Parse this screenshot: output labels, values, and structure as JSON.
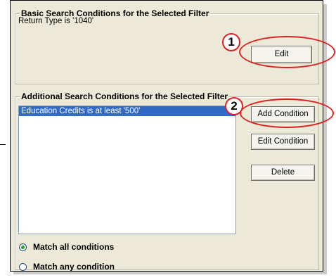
{
  "basic_group": {
    "title": "Basic Search Conditions for the Selected Filter",
    "condition_text": "Return Type is '1040'",
    "edit_label": "Edit"
  },
  "additional_group": {
    "title": "Additional Search Conditions for the Selected Filter",
    "list_items": [
      "Education Credits is at least '500'"
    ],
    "add_condition_label": "Add Condition",
    "edit_condition_label": "Edit Condition",
    "delete_label": "Delete"
  },
  "match_options": {
    "all_label": "Match all conditions",
    "any_label": "Match any condition",
    "selected": "all"
  },
  "callouts": [
    "1",
    "2"
  ],
  "colors": {
    "callout": "#e02020",
    "selection": "#316ac5"
  }
}
